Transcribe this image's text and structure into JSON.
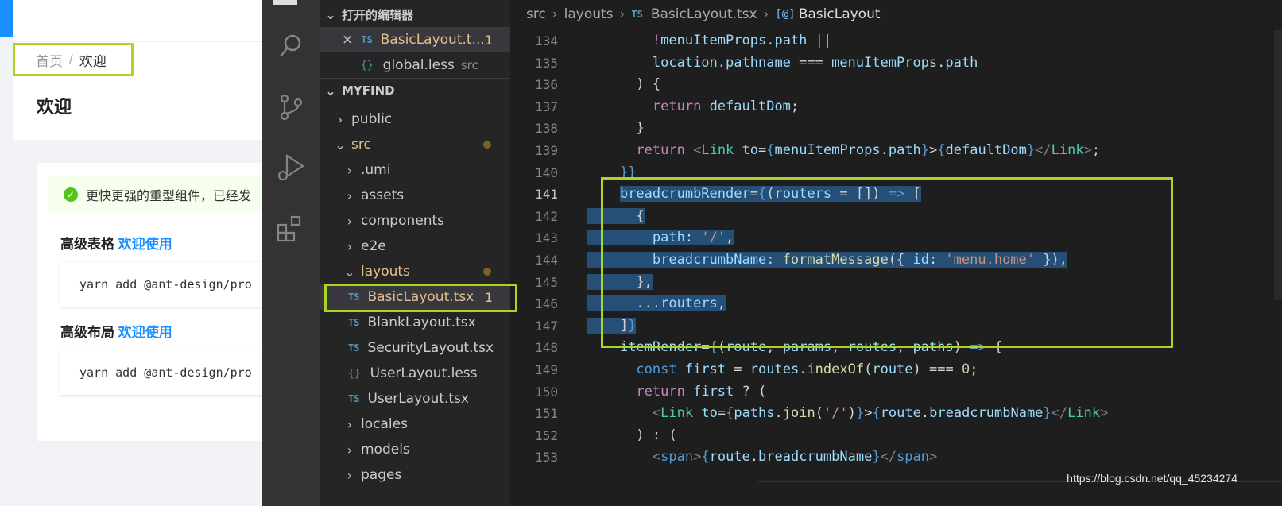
{
  "web": {
    "breadcrumb": {
      "home": "首页",
      "separator": "/",
      "current": "欢迎"
    },
    "page_title": "欢迎",
    "alert_text": "更快更强的重型组件，已经发",
    "sections": [
      {
        "title": "高级表格",
        "link": "欢迎使用",
        "code": "yarn add @ant-design/pro"
      },
      {
        "title": "高级布局",
        "link": "欢迎使用",
        "code": "yarn add @ant-design/pro"
      }
    ]
  },
  "vscode": {
    "activity_icons": [
      "explorer-icon",
      "search-icon",
      "source-control-icon",
      "run-debug-icon",
      "extensions-icon"
    ],
    "open_editors": {
      "header": "打开的编辑器",
      "items": [
        {
          "close": "×",
          "lang": "TS",
          "name": "BasicLayout.t...",
          "badge": "1"
        },
        {
          "lang": "{}",
          "name": "global.less",
          "hint": "src"
        }
      ]
    },
    "explorer": {
      "header": "MYFIND",
      "items": [
        {
          "chevron": ">",
          "name": "public"
        },
        {
          "chevron": "v",
          "name": "src"
        },
        {
          "chevron": ">",
          "name": ".umi"
        },
        {
          "chevron": ">",
          "name": "assets"
        },
        {
          "chevron": ">",
          "name": "components"
        },
        {
          "chevron": ">",
          "name": "e2e"
        },
        {
          "chevron": "v",
          "name": "layouts"
        },
        {
          "lang": "TS",
          "name": "BasicLayout.tsx",
          "badge": "1"
        },
        {
          "lang": "TS",
          "name": "BlankLayout.tsx"
        },
        {
          "lang": "TS",
          "name": "SecurityLayout.tsx"
        },
        {
          "lang": "{}",
          "name": "UserLayout.less"
        },
        {
          "lang": "TS",
          "name": "UserLayout.tsx"
        },
        {
          "chevron": ">",
          "name": "locales"
        },
        {
          "chevron": ">",
          "name": "models"
        },
        {
          "chevron": ">",
          "name": "pages"
        }
      ]
    },
    "breadcrumbs": {
      "a": "src",
      "b": "layouts",
      "lang": "TS",
      "file": "BasicLayout.tsx",
      "symbol_icon": "[@]",
      "symbol": "BasicLayout"
    },
    "line_numbers": [
      "134",
      "135",
      "136",
      "137",
      "138",
      "139",
      "140",
      "141",
      "142",
      "143",
      "144",
      "145",
      "146",
      "147",
      "148",
      "149",
      "150",
      "151",
      "152",
      "153"
    ],
    "watermark": "https://blog.csdn.net/qq_45234274"
  }
}
